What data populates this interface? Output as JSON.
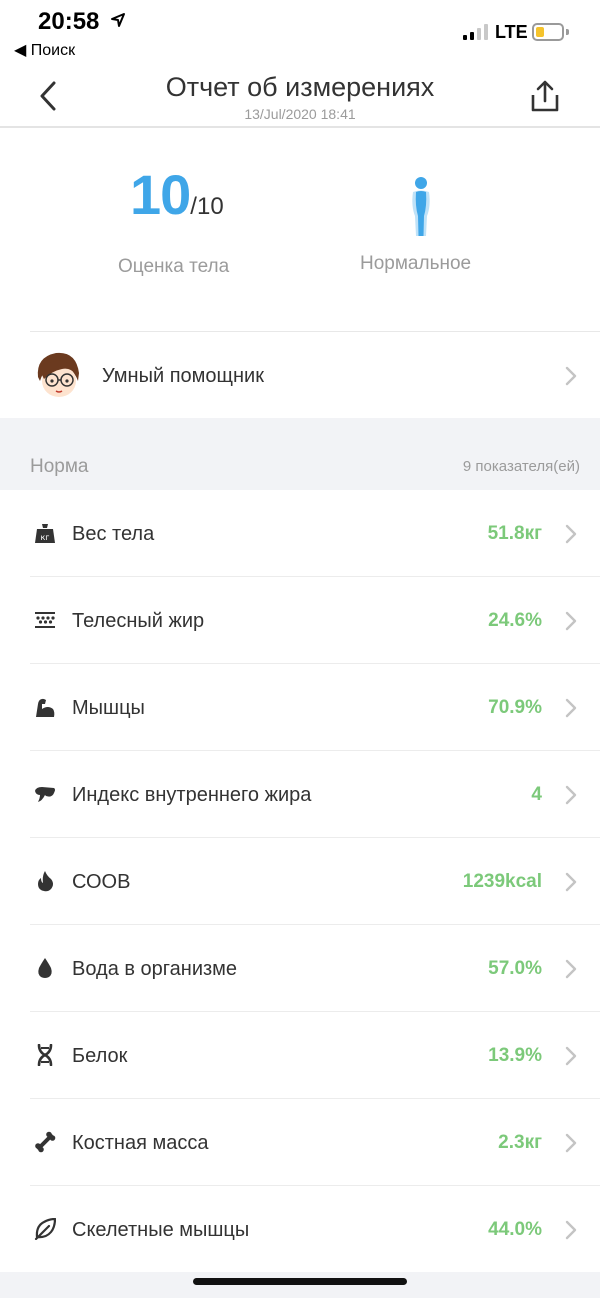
{
  "status": {
    "time": "20:58",
    "back_app": "◀ Поиск",
    "network": "LTE"
  },
  "nav": {
    "title": "Отчет об измерениях",
    "subtitle": "13/Jul/2020 18:41"
  },
  "summary": {
    "score": "10",
    "score_max": "/10",
    "score_label": "Оценка тела",
    "body_type": "Нормальное",
    "accent": "#3fa6e8"
  },
  "assistant": {
    "label": "Умный помощник"
  },
  "section": {
    "title": "Норма",
    "count": "9 показателя(ей)"
  },
  "metrics": [
    {
      "label": "Вес тела",
      "value": "51.8кг",
      "icon": "weight-icon"
    },
    {
      "label": "Телесный жир",
      "value": "24.6%",
      "icon": "body-fat-icon"
    },
    {
      "label": "Мышцы",
      "value": "70.9%",
      "icon": "muscle-icon"
    },
    {
      "label": "Индекс внутреннего жира",
      "value": "4",
      "icon": "visceral-fat-icon"
    },
    {
      "label": "СООВ",
      "value": "1239kcal",
      "icon": "flame-icon"
    },
    {
      "label": "Вода в организме",
      "value": "57.0%",
      "icon": "water-drop-icon"
    },
    {
      "label": "Белок",
      "value": "13.9%",
      "icon": "dna-icon"
    },
    {
      "label": "Костная масса",
      "value": "2.3кг",
      "icon": "bone-icon"
    },
    {
      "label": "Скелетные мышцы",
      "value": "44.0%",
      "icon": "leaf-icon"
    }
  ],
  "value_color": "#7cc97a"
}
